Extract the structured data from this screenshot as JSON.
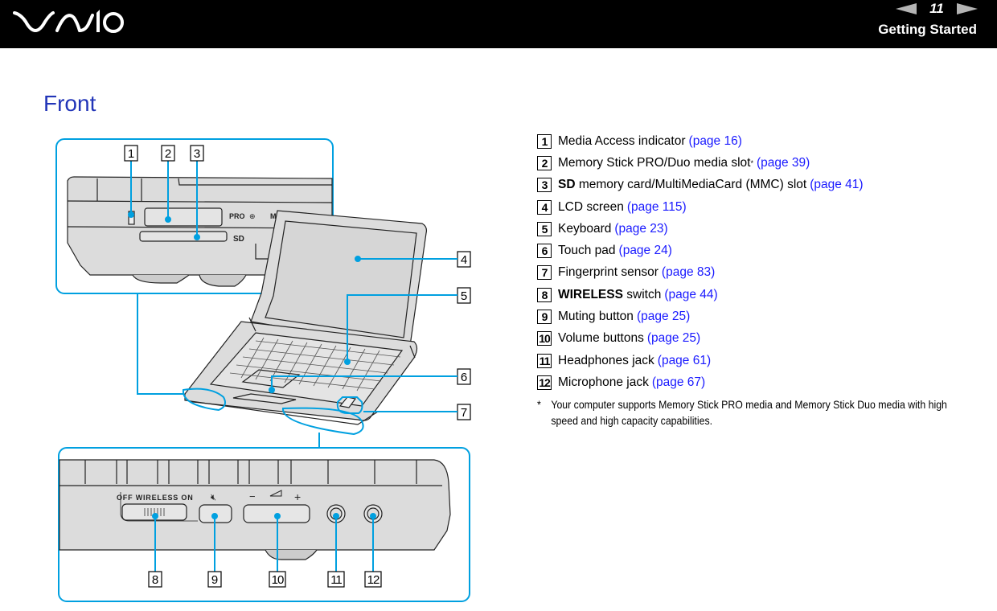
{
  "header": {
    "brand": "VAIO",
    "page_number": "11",
    "section": "Getting Started",
    "prev_icon": "previous-page-arrow-icon",
    "next_icon": "next-page-arrow-icon"
  },
  "title": "Front",
  "items": [
    {
      "num": "1",
      "bold": "",
      "label": "Media Access indicator",
      "sup": "",
      "link": "(page 16)"
    },
    {
      "num": "2",
      "bold": "",
      "label": "Memory Stick PRO/Duo media slot",
      "sup": "*",
      "link": "(page 39)"
    },
    {
      "num": "3",
      "bold": "SD",
      "label": " memory card/MultiMediaCard (MMC) slot",
      "sup": "",
      "link": "(page 41)"
    },
    {
      "num": "4",
      "bold": "",
      "label": "LCD screen",
      "sup": "",
      "link": "(page 115)"
    },
    {
      "num": "5",
      "bold": "",
      "label": "Keyboard",
      "sup": "",
      "link": "(page 23)"
    },
    {
      "num": "6",
      "bold": "",
      "label": "Touch pad",
      "sup": "",
      "link": "(page 24)"
    },
    {
      "num": "7",
      "bold": "",
      "label": "Fingerprint sensor",
      "sup": "",
      "link": "(page 83)"
    },
    {
      "num": "8",
      "bold": "WIRELESS",
      "label": " switch",
      "sup": "",
      "link": "(page 44)"
    },
    {
      "num": "9",
      "bold": "",
      "label": "Muting button",
      "sup": "",
      "link": "(page 25)"
    },
    {
      "num": "10",
      "bold": "",
      "label": "Volume buttons",
      "sup": "",
      "link": "(page 25)"
    },
    {
      "num": "11",
      "bold": "",
      "label": "Headphones jack",
      "sup": "",
      "link": "(page 61)"
    },
    {
      "num": "12",
      "bold": "",
      "label": "Microphone jack",
      "sup": "",
      "link": "(page 67)"
    }
  ],
  "footnote": {
    "mark": "*",
    "text": "Your computer supports Memory Stick PRO media and Memory Stick Duo media with high speed and high capacity capabilities."
  },
  "illustration": {
    "callout_color": "#00a0e0",
    "front_labels": {
      "pro": "PRO",
      "magicgate": "MAGICGATE",
      "sd": "SD"
    },
    "side_labels": {
      "wireless": "OFF  WIRELESS  ON",
      "minus": "−",
      "plus": "+"
    },
    "callouts_top": [
      "1",
      "2",
      "3"
    ],
    "callouts_right": [
      "4",
      "5",
      "6",
      "7"
    ],
    "callouts_bottom": [
      "8",
      "9",
      "10",
      "11",
      "12"
    ]
  }
}
